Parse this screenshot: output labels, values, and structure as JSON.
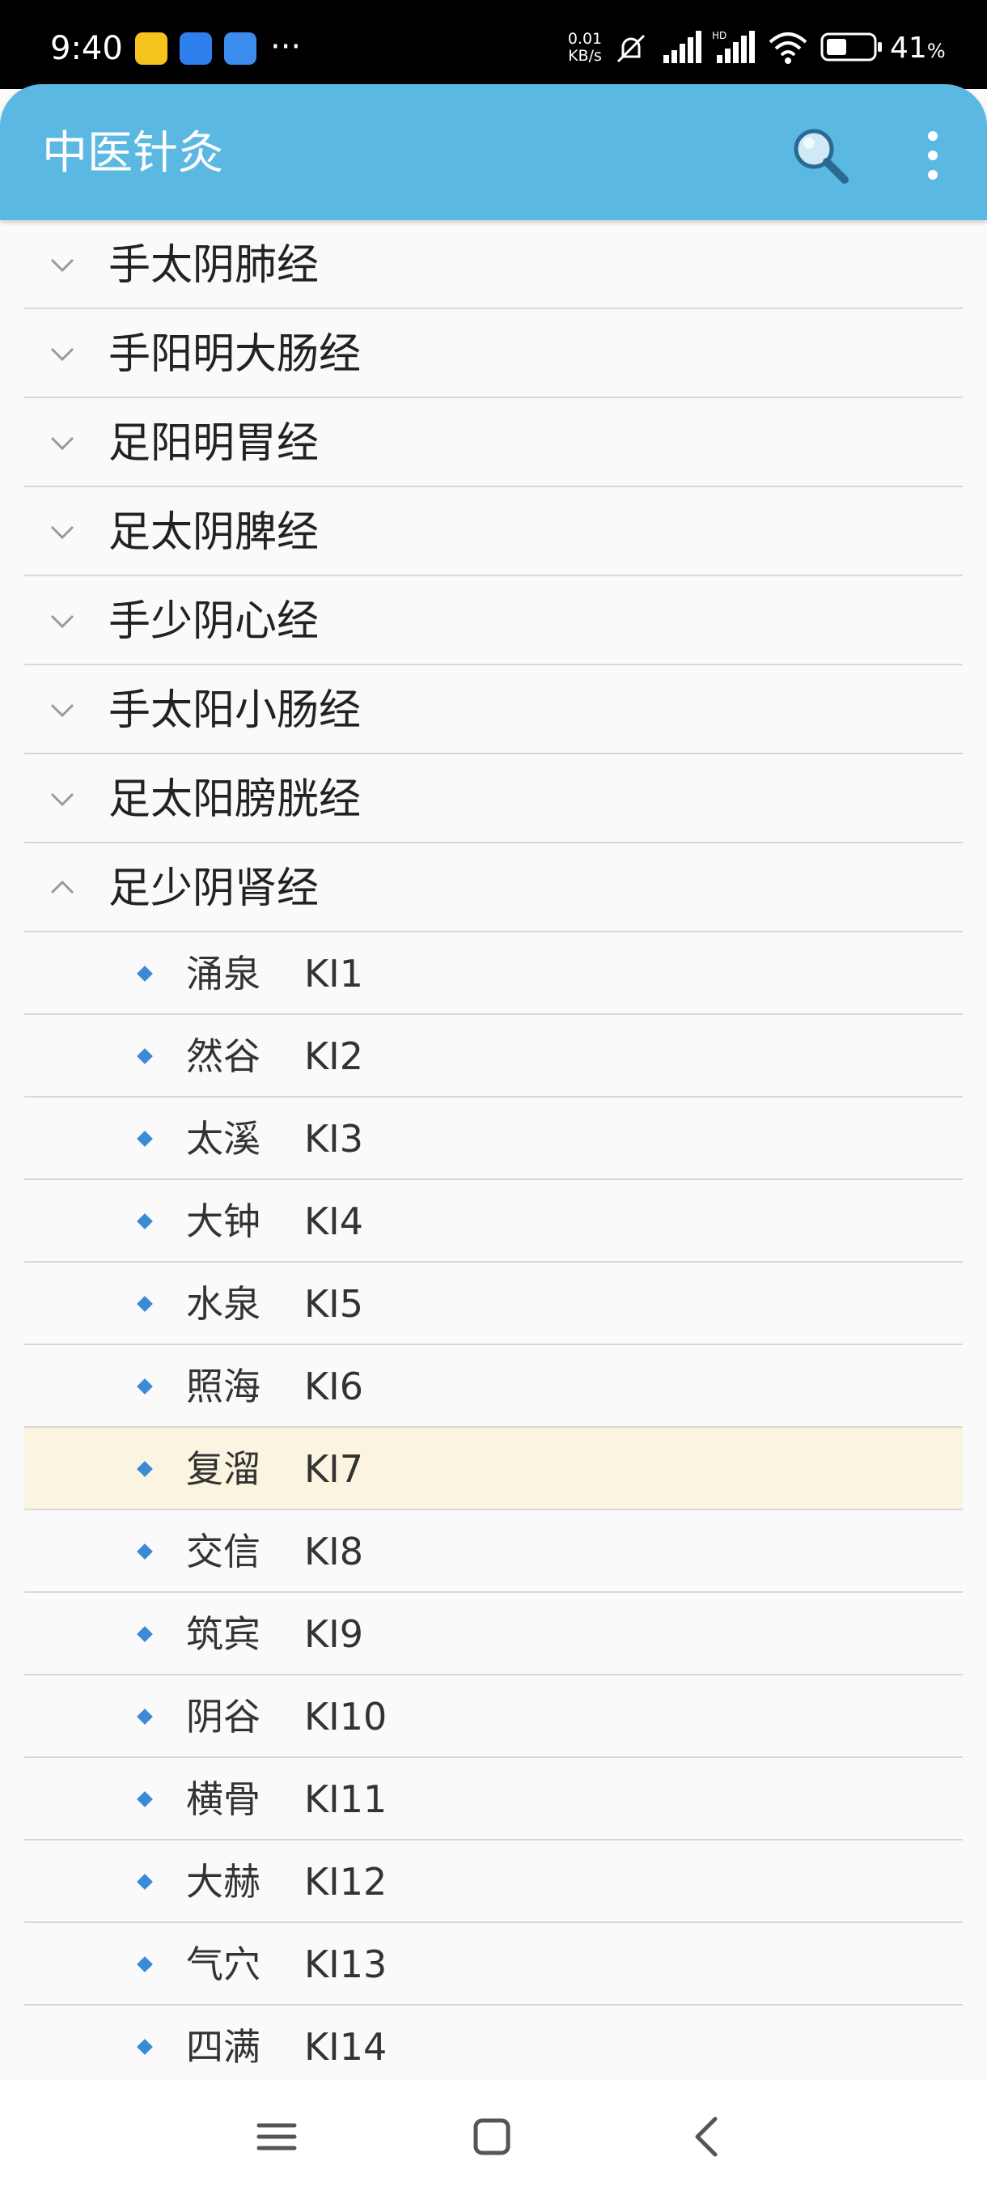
{
  "status_bar": {
    "time": "9:40",
    "network_speed_value": "0.01",
    "network_speed_unit": "KB/s",
    "battery_percent": "41",
    "battery_suffix": "%",
    "icons": [
      "app-icon-1",
      "app-icon-2",
      "app-icon-3",
      "more-dots-icon",
      "mute-icon",
      "signal-icon",
      "hd-signal-icon",
      "wifi-icon",
      "battery-icon"
    ]
  },
  "app_bar": {
    "title": "中医针灸",
    "icons": [
      "search-icon",
      "more-vert-icon"
    ]
  },
  "meridians": [
    {
      "label": "手太阴肺经",
      "expanded": false
    },
    {
      "label": "手阳明大肠经",
      "expanded": false
    },
    {
      "label": "足阳明胃经",
      "expanded": false
    },
    {
      "label": "足太阴脾经",
      "expanded": false
    },
    {
      "label": "手少阴心经",
      "expanded": false
    },
    {
      "label": "手太阳小肠经",
      "expanded": false
    },
    {
      "label": "足太阳膀胱经",
      "expanded": false
    },
    {
      "label": "足少阴肾经",
      "expanded": true
    }
  ],
  "points": [
    {
      "name": "涌泉",
      "code": "KI1"
    },
    {
      "name": "然谷",
      "code": "KI2"
    },
    {
      "name": "太溪",
      "code": "KI3"
    },
    {
      "name": "大钟",
      "code": "KI4"
    },
    {
      "name": "水泉",
      "code": "KI5"
    },
    {
      "name": "照海",
      "code": "KI6"
    },
    {
      "name": "复溜",
      "code": "KI7"
    },
    {
      "name": "交信",
      "code": "KI8"
    },
    {
      "name": "筑宾",
      "code": "KI9"
    },
    {
      "name": "阴谷",
      "code": "KI10"
    },
    {
      "name": "横骨",
      "code": "KI11"
    },
    {
      "name": "大赫",
      "code": "KI12"
    },
    {
      "name": "气穴",
      "code": "KI13"
    },
    {
      "name": "四满",
      "code": "KI14"
    }
  ],
  "selected_point": "KI7",
  "colors": {
    "app_bar": "#5ab8e2",
    "selected_row": "#faf4e1",
    "bullet": "#3a8ad8"
  },
  "nav_bar": {
    "icons": [
      "menu-icon",
      "home-icon",
      "back-icon"
    ]
  }
}
